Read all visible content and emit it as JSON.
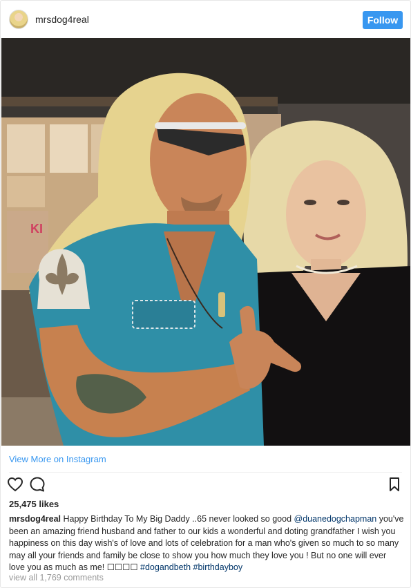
{
  "post": {
    "username": "mrsdog4real",
    "follow_label": "Follow",
    "view_more_label": "View More on Instagram",
    "likes_text": "25,475 likes",
    "caption": {
      "user": "mrsdog4real",
      "text_1": " Happy Birthday To My Big Daddy ..65 never looked so good ",
      "mention": "@duanedogchapman",
      "text_2": " you've been an amazing friend husband and father to our kids a wonderful and doting grandfather I wish you happiness on this day wish's of love and lots of celebration for a man who's given so much to so many may all your friends and family be close to show you how much they love you ! But no one will ever love you as much as me! ☐☐☐☐ ",
      "hashtag_1": "#dogandbeth",
      "hashtag_2": "#birthdayboy"
    },
    "comments_link": "view all 1,769 comments"
  },
  "icons": {
    "like": "heart-icon",
    "comment": "comment-bubble-icon",
    "save": "bookmark-icon"
  },
  "colors": {
    "follow_bg": "#3897f0",
    "link": "#3897f0",
    "hashtag": "#003569"
  }
}
